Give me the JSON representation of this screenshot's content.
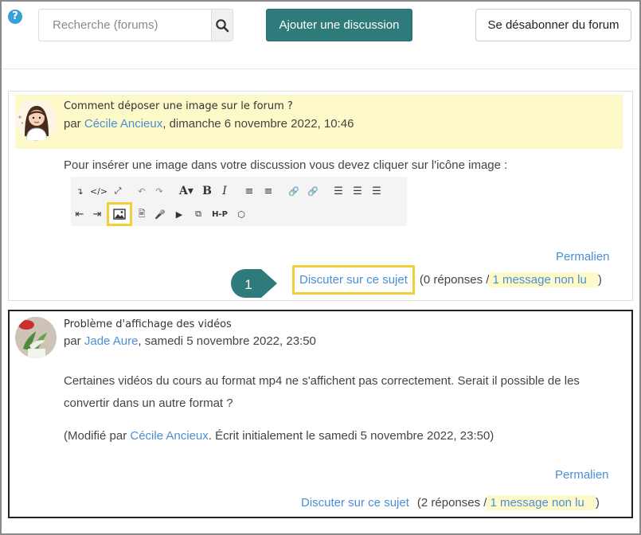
{
  "toolbar_top": {
    "help_glyph": "?",
    "search_placeholder": "Recherche (forums)",
    "add_label": "Ajouter une discussion",
    "unsubscribe_label": "Se désabonner du forum"
  },
  "colors": {
    "accent": "#2f7b7c",
    "link": "#4a8fd6",
    "highlight": "#f0cf3a",
    "post_header_bg": "#fef9c8"
  },
  "posts": [
    {
      "subject": "Comment déposer une image sur le forum ?",
      "by": "par",
      "author": "Cécile Ancieux",
      "date": ", dimanche 6 novembre 2022, 10:46",
      "body": "Pour insérer une image dans votre discussion vous devez cliquer sur l'icône image :",
      "permalink": "Permalien",
      "discuss": "Discuter sur ce sujet",
      "replies": "(0 réponses / ",
      "unread": "1 message non lu",
      "close": ")"
    },
    {
      "subject": "Problème d'affichage des vidéos",
      "by": "par",
      "author": "Jade Aure",
      "date": ", samedi 5 novembre 2022, 23:50",
      "body": "Certaines vidéos du cours au format mp4 ne s'affichent pas correctement. Serait il possible de les convertir dans un autre format ?",
      "edit_prefix": "(Modifié par ",
      "edit_author": "Cécile Ancieux",
      "edit_suffix": ". Écrit initialement le samedi 5 novembre 2022, 23:50)",
      "permalink": "Permalien",
      "discuss": "Discuter sur ce sujet",
      "replies": "(2 réponses / ",
      "unread": "1 message non lu",
      "close": ")"
    }
  ],
  "editor_toolbar": {
    "bold": "B",
    "italic": "I",
    "font": "A",
    "h5p": "H-P"
  },
  "callout": {
    "number": "1"
  }
}
